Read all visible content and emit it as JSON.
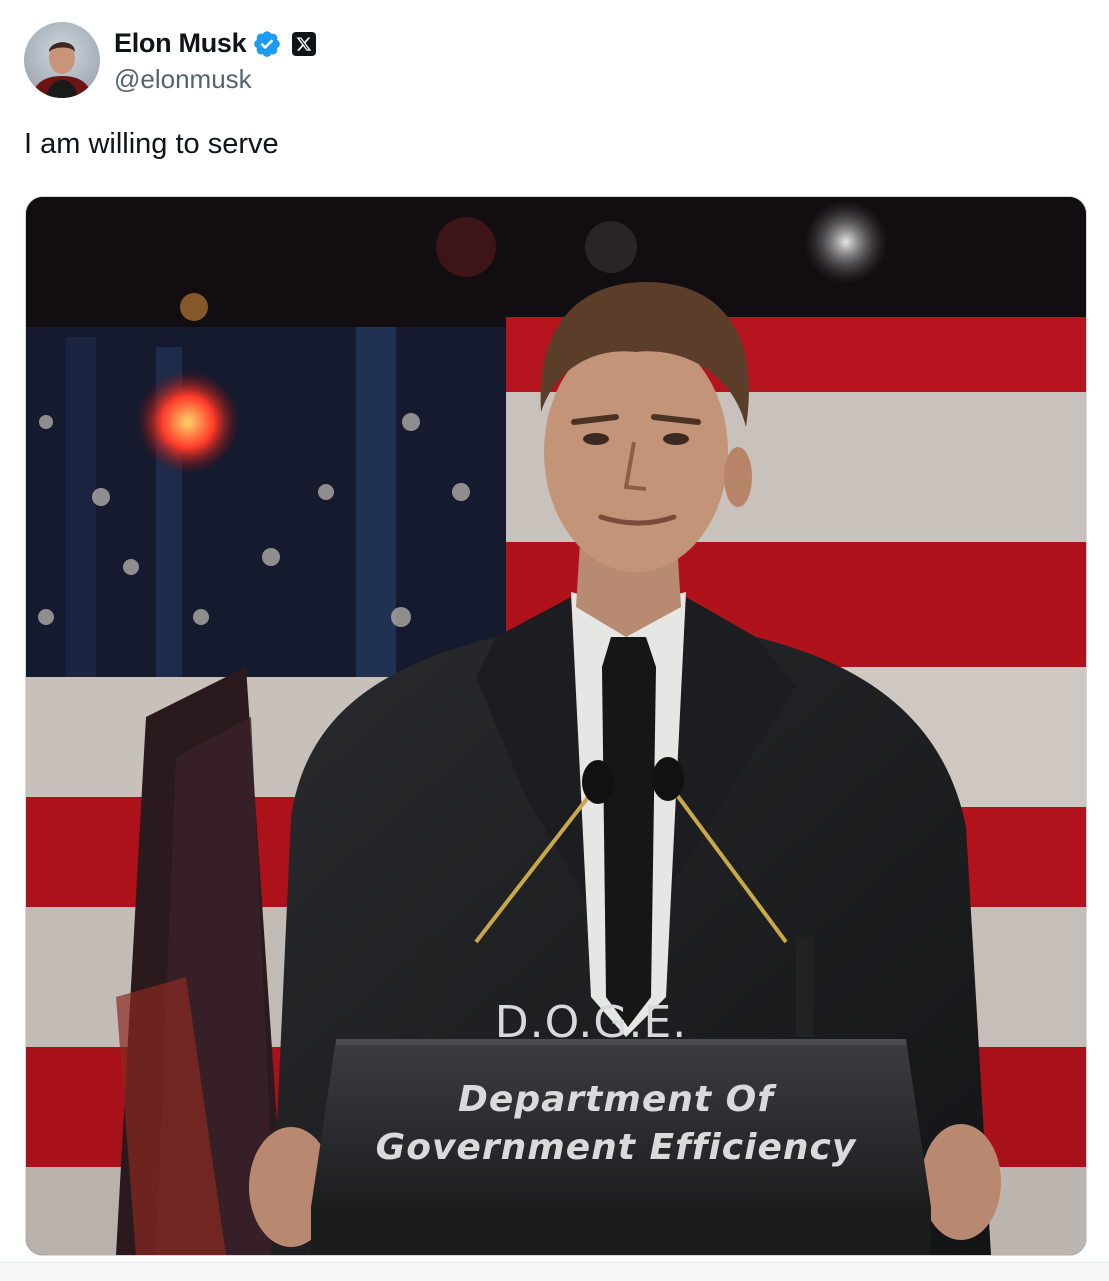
{
  "author": {
    "display_name": "Elon Musk",
    "handle": "@elonmusk",
    "verified_icon": "verified-badge-icon",
    "affiliation_icon": "x-logo-icon"
  },
  "tweet": {
    "text": "I am willing to serve"
  },
  "media": {
    "podium_title": "D.O.G.E.",
    "podium_line1": "Department Of",
    "podium_line2": "Government Efficiency"
  },
  "colors": {
    "verified_blue": "#1d9bf0",
    "text_primary": "#0f1419",
    "text_secondary": "#536471"
  }
}
